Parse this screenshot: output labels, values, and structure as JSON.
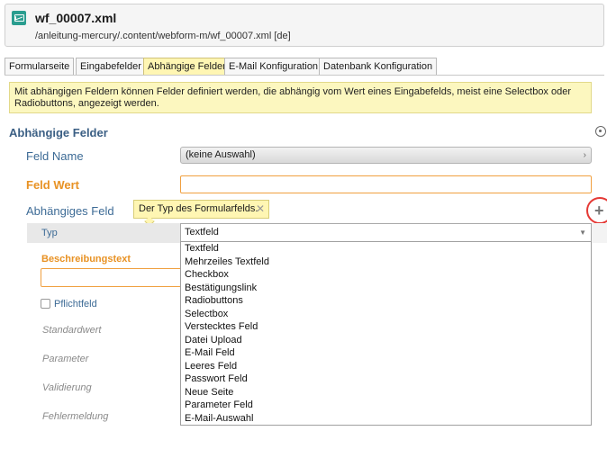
{
  "header": {
    "title": "wf_00007.xml",
    "path": "/anleitung-mercury/.content/webform-m/wf_00007.xml [de]",
    "icon": "form-file-icon"
  },
  "tabs": [
    {
      "label": "Formularseite",
      "active": false
    },
    {
      "label": "Eingabefelder",
      "active": false
    },
    {
      "label": "Abhängige Felder",
      "active": true
    },
    {
      "label": "E-Mail Konfiguration",
      "active": false
    },
    {
      "label": "Datenbank Konfiguration",
      "active": false
    }
  ],
  "info_text": "Mit abhängigen Feldern können Felder definiert werden, die abhängig vom Wert eines Eingabefelds, meist eine Selectbox oder Radiobuttons, angezeigt werden.",
  "section": {
    "title": "Abhängige Felder"
  },
  "fields": {
    "feld_name": {
      "label": "Feld Name",
      "value": "(keine Auswahl)"
    },
    "feld_wert": {
      "label": "Feld Wert",
      "value": ""
    },
    "abhaengiges_feld": {
      "label": "Abhängiges Feld"
    }
  },
  "tooltip": {
    "text": "Der Typ des Formularfelds."
  },
  "subfields": {
    "typ": {
      "label": "Typ",
      "value": "Textfeld"
    },
    "beschreibungstext": {
      "label": "Beschreibungstext"
    },
    "pflichtfeld": {
      "label": "Pflichtfeld",
      "checked": false
    },
    "standardwert": {
      "label": "Standardwert"
    },
    "parameter": {
      "label": "Parameter"
    },
    "validierung": {
      "label": "Validierung"
    },
    "fehlermeldung": {
      "label": "Fehlermeldung"
    }
  },
  "typ_options": [
    "Textfeld",
    "Mehrzeiles Textfeld",
    "Checkbox",
    "Bestätigungslink",
    "Radiobuttons",
    "Selectbox",
    "Verstecktes Feld",
    "Datei Upload",
    "E-Mail Feld",
    "Leeres Feld",
    "Passwort Feld",
    "Neue Seite",
    "Parameter Feld",
    "E-Mail-Auswahl"
  ],
  "colors": {
    "accent_orange": "#e89224",
    "label_blue": "#3d6b96",
    "highlight_yellow": "#fff6b3",
    "annotation_red": "#e53935"
  }
}
